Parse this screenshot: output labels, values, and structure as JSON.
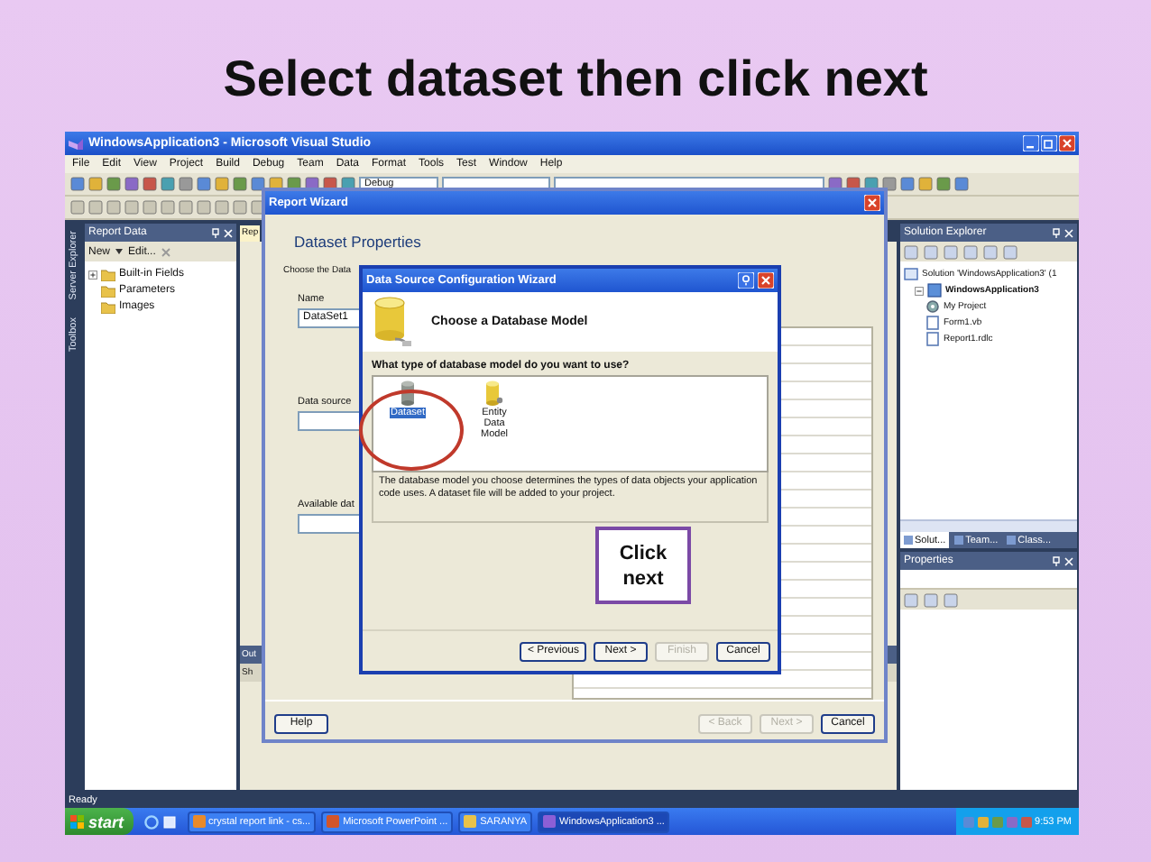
{
  "slide": {
    "title": "Select dataset then click next"
  },
  "window": {
    "title": "WindowsApplication3 - Microsoft Visual Studio"
  },
  "menu": [
    "File",
    "Edit",
    "View",
    "Project",
    "Build",
    "Debug",
    "Team",
    "Data",
    "Format",
    "Tools",
    "Test",
    "Window",
    "Help"
  ],
  "toolbar": {
    "configuration": "Debug"
  },
  "side_strip": [
    "Server Explorer",
    "Toolbox"
  ],
  "report_data": {
    "title": "Report Data",
    "actions": [
      "New",
      "Edit..."
    ],
    "tree": [
      {
        "label": "Built-in Fields",
        "expandable": true
      },
      {
        "label": "Parameters",
        "expandable": false
      },
      {
        "label": "Images",
        "expandable": false
      }
    ]
  },
  "document": {
    "tab": "Rep"
  },
  "output": {
    "title": "Out",
    "toolbar_label": "Sh"
  },
  "report_wizard": {
    "title": "Report Wizard",
    "heading": "Dataset Properties",
    "intro": "Choose the Data",
    "fields": [
      {
        "label": "Name",
        "value": "DataSet1"
      },
      {
        "label": "Data source"
      },
      {
        "label": "Available dat"
      }
    ],
    "buttons": [
      {
        "label": "Help",
        "disabled": false
      },
      {
        "label": "< Back",
        "disabled": true
      },
      {
        "label": "Next >",
        "disabled": true
      },
      {
        "label": "Cancel",
        "disabled": false
      }
    ]
  },
  "config_wizard": {
    "title": "Data Source Configuration Wizard",
    "heading": "Choose a Database Model",
    "question": "What type of database model do you want to use?",
    "models": [
      {
        "label": "Dataset",
        "kind": "dataset",
        "selected": true
      },
      {
        "label": "Entity Data Model",
        "kind": "entity",
        "selected": false
      }
    ],
    "description": "The database model you choose determines the types of data objects your application code uses. A dataset file will be added to your project.",
    "buttons": [
      {
        "label": "< Previous",
        "disabled": false
      },
      {
        "label": "Next >",
        "disabled": false
      },
      {
        "label": "Finish",
        "disabled": true
      },
      {
        "label": "Cancel",
        "disabled": false
      }
    ]
  },
  "annotation": {
    "text": "Click next"
  },
  "solution_explorer": {
    "title": "Solution Explorer",
    "tree": [
      {
        "label": "Solution 'WindowsApplication3' (1",
        "kind": "solution",
        "children": [
          {
            "label": "WindowsApplication3",
            "kind": "project",
            "children": [
              {
                "label": "My Project",
                "kind": "settings"
              },
              {
                "label": "Form1.vb",
                "kind": "file"
              },
              {
                "label": "Report1.rdlc",
                "kind": "file"
              }
            ]
          }
        ]
      }
    ],
    "tabs": [
      {
        "label": "Solut...",
        "selected": true
      },
      {
        "label": "Team...",
        "selected": false
      },
      {
        "label": "Class...",
        "selected": false
      }
    ]
  },
  "properties": {
    "title": "Properties"
  },
  "status_bar": "Ready",
  "taskbar": {
    "start": "start",
    "tasks": [
      {
        "label": "crystal report link - cs...",
        "kind": "browser",
        "selected": false
      },
      {
        "label": "Microsoft PowerPoint ...",
        "kind": "powerpoint",
        "selected": false
      },
      {
        "label": "SARANYA",
        "kind": "folder",
        "selected": false
      },
      {
        "label": "WindowsApplication3 ...",
        "kind": "studio",
        "selected": true
      }
    ],
    "clock": "9:53 PM"
  }
}
